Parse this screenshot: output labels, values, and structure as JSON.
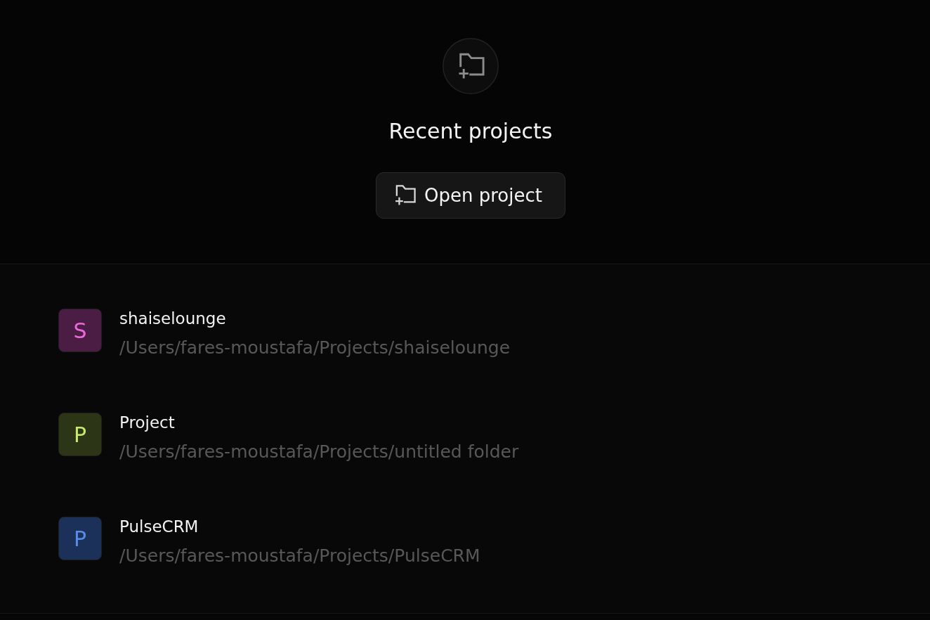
{
  "header": {
    "title": "Recent projects",
    "open_button": {
      "label": "Open project"
    }
  },
  "projects": [
    {
      "initial": "S",
      "name": "shaiselounge",
      "path": "/Users/fares-moustafa/Projects/shaiselounge",
      "color": "#4b1d45"
    },
    {
      "initial": "P",
      "name": "Project",
      "path": "/Users/fares-moustafa/Projects/untitled folder",
      "color": "#2c3515"
    },
    {
      "initial": "P",
      "name": "PulseCRM",
      "path": "/Users/fares-moustafa/Projects/PulseCRM",
      "color": "#1b3159"
    }
  ]
}
